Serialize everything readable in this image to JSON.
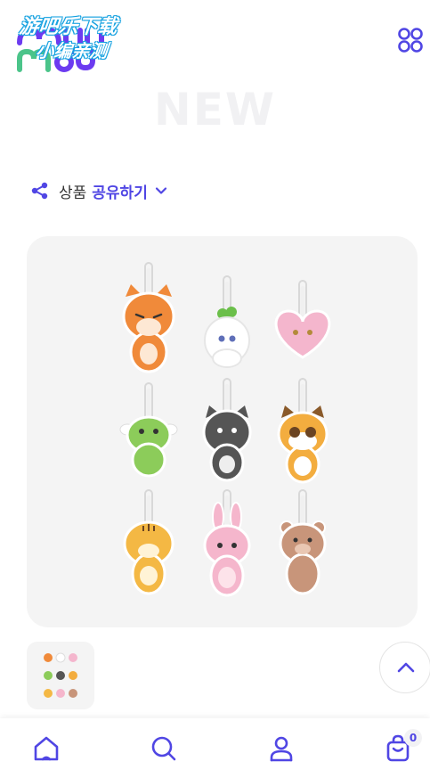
{
  "header": {
    "logo_name": "moo-logo",
    "watermark_line1": "游吧乐下载",
    "watermark_line2": "小编亲测",
    "menu_icon": "grid-dots-icon"
  },
  "section": {
    "title": "NEW"
  },
  "share": {
    "label": "상품",
    "accent": "공유하기",
    "icon": "share-icon"
  },
  "product": {
    "image_alt": "keyring-plush-set",
    "thumbnail_alt": "keyring-plush-set-thumbnail"
  },
  "scroll_top": {
    "icon": "chevron-up-icon"
  },
  "bottom_nav": {
    "items": [
      {
        "name": "home",
        "icon": "home-icon"
      },
      {
        "name": "search",
        "icon": "search-icon"
      },
      {
        "name": "my-page",
        "icon": "user-icon"
      },
      {
        "name": "cart",
        "icon": "shopping-bag-icon"
      }
    ],
    "cart_count": "0"
  },
  "colors": {
    "accent": "#5046e4",
    "panel": "#f4f4f4",
    "title_ghost": "#f1f1f3"
  }
}
